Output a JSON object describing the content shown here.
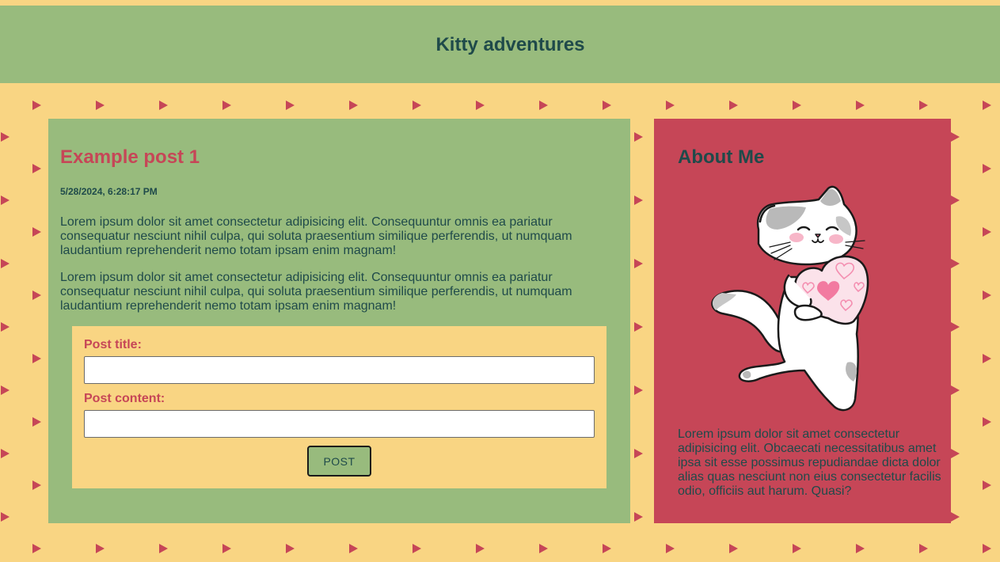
{
  "header": {
    "site_title": "Kitty adventures"
  },
  "post": {
    "title": "Example post 1",
    "date": "5/28/2024, 6:28:17 PM",
    "paragraphs": [
      "Lorem ipsum dolor sit amet consectetur adipisicing elit. Consequuntur omnis ea pariatur consequatur nesciunt nihil culpa, qui soluta praesentium similique perferendis, ut numquam laudantium reprehenderit nemo totam ipsam enim magnam!",
      "Lorem ipsum dolor sit amet consectetur adipisicing elit. Consequuntur omnis ea pariatur consequatur nesciunt nihil culpa, qui soluta praesentium similique perferendis, ut numquam laudantium reprehenderit nemo totam ipsam enim magnam!"
    ]
  },
  "form": {
    "title_label": "Post title:",
    "title_value": "",
    "content_label": "Post content:",
    "content_value": "",
    "submit_label": "POST"
  },
  "about": {
    "title": "About Me",
    "image_icon": "cat-holding-heart-illustration",
    "text": "Lorem ipsum dolor sit amet consectetur adipisicing elit. Obcaecati necessitatibus amet ipsa sit esse possimus repudiandae dicta dolor alias quas nesciunt non eius consectetur facilis odio, officiis aut harum. Quasi?"
  },
  "colors": {
    "background": "#f9d583",
    "green_panel": "#98bb7d",
    "rose_panel": "#c64657",
    "dark_text": "#1f4a4a",
    "accent_text": "#c64657",
    "triangle_pattern": "#c64657"
  }
}
